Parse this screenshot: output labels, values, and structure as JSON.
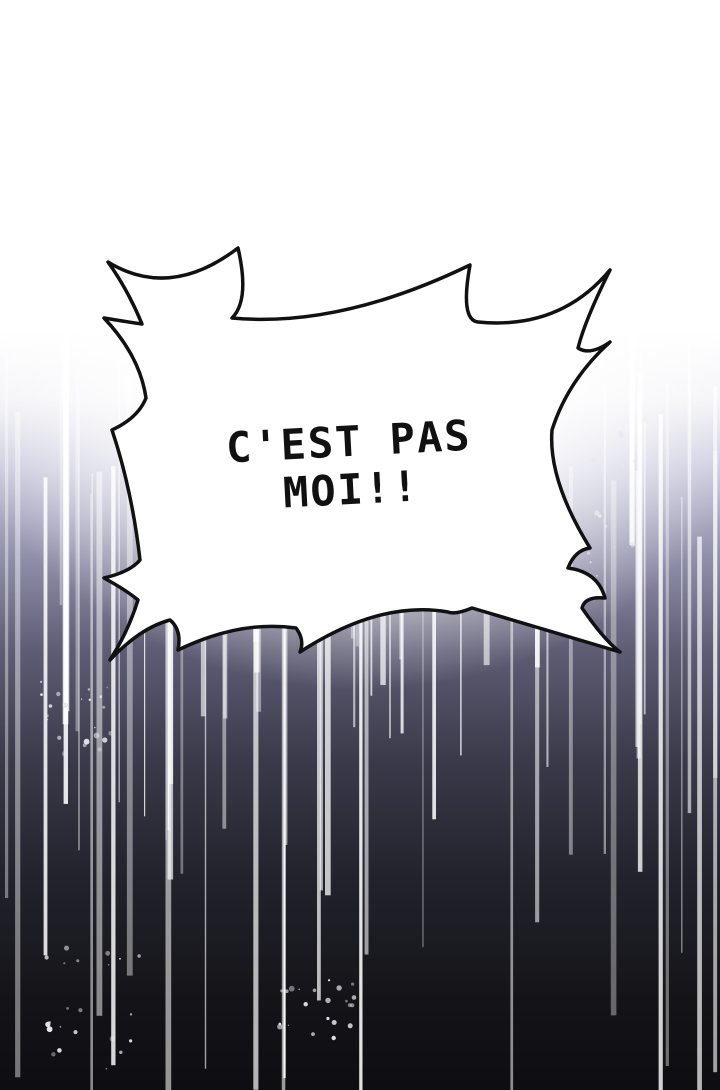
{
  "bubble": {
    "line1": "C'EST PAS",
    "line2": "MOI!!"
  },
  "colors": {
    "top": "#ffffff",
    "mid": "#8f8ea8",
    "bottom": "#0e0e12",
    "bubble_fill": "#ffffff",
    "bubble_outline": "#111111"
  }
}
